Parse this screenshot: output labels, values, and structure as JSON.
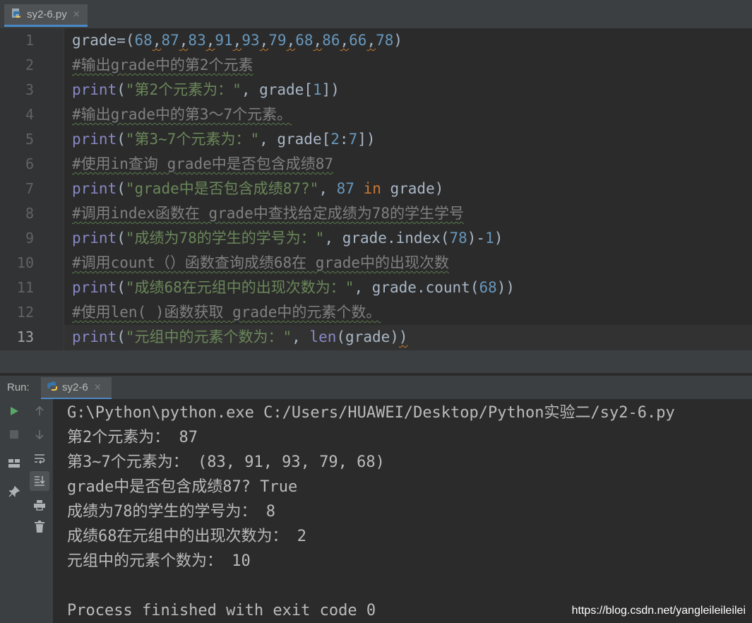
{
  "file_tab": {
    "label": "sy2-6.py",
    "close": "×"
  },
  "editor": {
    "line_numbers": [
      "1",
      "2",
      "3",
      "4",
      "5",
      "6",
      "7",
      "8",
      "9",
      "10",
      "11",
      "12",
      "13"
    ],
    "current_line": "13",
    "lines": [
      [
        {
          "t": "grade=("
        },
        {
          "t": "68",
          "c": "num"
        },
        {
          "t": ",",
          "c": "sq"
        },
        {
          "t": "87",
          "c": "num"
        },
        {
          "t": ",",
          "c": "sq"
        },
        {
          "t": "83",
          "c": "num"
        },
        {
          "t": ",",
          "c": "sq"
        },
        {
          "t": "91",
          "c": "num"
        },
        {
          "t": ",",
          "c": "sq"
        },
        {
          "t": "93",
          "c": "num"
        },
        {
          "t": ",",
          "c": "sq"
        },
        {
          "t": "79",
          "c": "num"
        },
        {
          "t": ",",
          "c": "sq"
        },
        {
          "t": "68",
          "c": "num"
        },
        {
          "t": ",",
          "c": "sq"
        },
        {
          "t": "86",
          "c": "num"
        },
        {
          "t": ",",
          "c": "sq"
        },
        {
          "t": "66",
          "c": "num"
        },
        {
          "t": ",",
          "c": "sq"
        },
        {
          "t": "78",
          "c": "num"
        },
        {
          "t": ")"
        }
      ],
      [
        {
          "t": "#输出grade中的第2个元素",
          "c": "com"
        }
      ],
      [
        {
          "t": "print",
          "c": "kw"
        },
        {
          "t": "("
        },
        {
          "t": "\"第2个元素为：\"",
          "c": "str"
        },
        {
          "t": ", grade["
        },
        {
          "t": "1",
          "c": "num"
        },
        {
          "t": "])"
        }
      ],
      [
        {
          "t": "#输出grade中的第3～7个元素。",
          "c": "com"
        }
      ],
      [
        {
          "t": "print",
          "c": "kw"
        },
        {
          "t": "("
        },
        {
          "t": "\"第3~7个元素为：\"",
          "c": "str"
        },
        {
          "t": ", grade["
        },
        {
          "t": "2",
          "c": "num"
        },
        {
          "t": ":"
        },
        {
          "t": "7",
          "c": "num"
        },
        {
          "t": "])"
        }
      ],
      [
        {
          "t": "#使用in查询 grade中是否包含成绩87",
          "c": "com"
        }
      ],
      [
        {
          "t": "print",
          "c": "kw"
        },
        {
          "t": "("
        },
        {
          "t": "\"grade中是否包含成绩87?\"",
          "c": "str"
        },
        {
          "t": ", "
        },
        {
          "t": "87",
          "c": "num"
        },
        {
          "t": " "
        },
        {
          "t": "in",
          "c": "inkw"
        },
        {
          "t": " grade)"
        }
      ],
      [
        {
          "t": "#调用index函数在 grade中查找给定成绩为78的学生学号",
          "c": "com"
        }
      ],
      [
        {
          "t": "print",
          "c": "kw"
        },
        {
          "t": "("
        },
        {
          "t": "\"成绩为78的学生的学号为：\"",
          "c": "str"
        },
        {
          "t": ", grade.index("
        },
        {
          "t": "78",
          "c": "num"
        },
        {
          "t": ")-"
        },
        {
          "t": "1",
          "c": "num"
        },
        {
          "t": ")"
        }
      ],
      [
        {
          "t": "#调用count（）函数查询成绩68在 grade中的出现次数",
          "c": "com"
        }
      ],
      [
        {
          "t": "print",
          "c": "kw"
        },
        {
          "t": "("
        },
        {
          "t": "\"成绩68在元组中的出现次数为：\"",
          "c": "str"
        },
        {
          "t": ", grade.count("
        },
        {
          "t": "68",
          "c": "num"
        },
        {
          "t": "))"
        }
      ],
      [
        {
          "t": "#使用len( )函数获取 grade中的元素个数。",
          "c": "com"
        }
      ],
      [
        {
          "t": "print",
          "c": "kw"
        },
        {
          "t": "("
        },
        {
          "t": "\"元组中的元素个数为：\"",
          "c": "str"
        },
        {
          "t": ", "
        },
        {
          "t": "len",
          "c": "kw"
        },
        {
          "t": "(grade)"
        },
        {
          "t": ")",
          "c": "sq"
        }
      ]
    ]
  },
  "run_panel": {
    "label": "Run:",
    "tab_label": "sy2-6",
    "tab_close": "×",
    "output": [
      "G:\\Python\\python.exe C:/Users/HUAWEI/Desktop/Python实验二/sy2-6.py",
      "第2个元素为： 87",
      "第3~7个元素为： (83, 91, 93, 79, 68)",
      "grade中是否包含成绩87? True",
      "成绩为78的学生的学号为： 8",
      "成绩68在元组中的出现次数为： 2",
      "元组中的元素个数为： 10",
      "",
      "Process finished with exit code 0"
    ]
  },
  "watermark": "https://blog.csdn.net/yangleileileilei",
  "colors": {
    "keyword": "#8888c6",
    "string": "#6a8759",
    "number": "#6897bb",
    "comment": "#808080",
    "in_keyword": "#cc7832",
    "run_green": "#59a869"
  }
}
